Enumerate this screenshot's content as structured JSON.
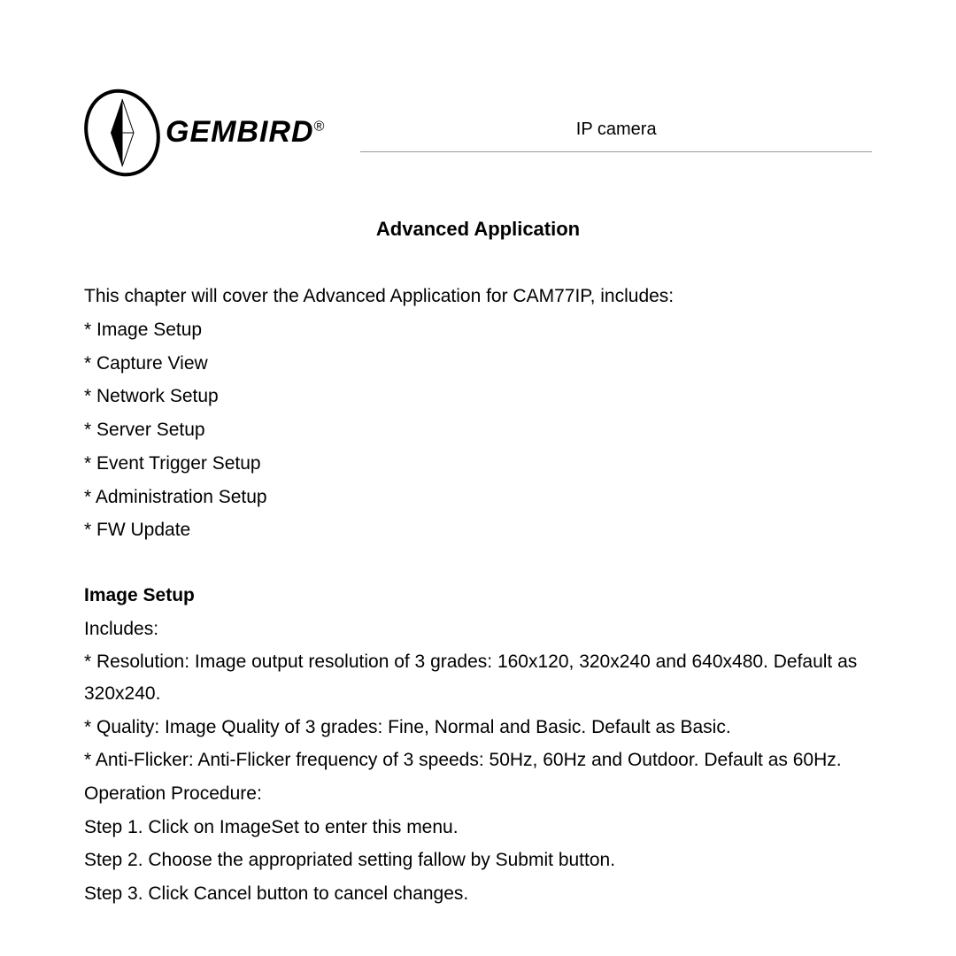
{
  "logo": {
    "text": "GEMBIRD",
    "registered": "®"
  },
  "doc_label": "IP camera",
  "title": "Advanced Application",
  "intro": "This chapter will cover the Advanced Application for CAM77IP, includes:",
  "toc": {
    "i0": "* Image Setup",
    "i1": "* Capture View",
    "i2": "* Network Setup",
    "i3": "* Server Setup",
    "i4": "* Event Trigger Setup",
    "i5": "* Administration Setup",
    "i6": "* FW Update"
  },
  "section": {
    "heading": "Image Setup",
    "includes_label": "Includes:",
    "b0": "* Resolution: Image output resolution of 3 grades: 160x120, 320x240 and 640x480. Default as 320x240.",
    "b1": "* Quality: Image Quality of 3 grades: Fine, Normal and Basic. Default as Basic.",
    "b2": "* Anti-Flicker: Anti-Flicker frequency of 3 speeds: 50Hz, 60Hz and Outdoor. Default as 60Hz.",
    "op_label": "Operation Procedure:",
    "s0": "Step 1. Click on ImageSet to enter this menu.",
    "s1": "Step 2. Choose the appropriated setting fallow by Submit button.",
    "s2": "Step 3. Click Cancel button to cancel changes."
  }
}
